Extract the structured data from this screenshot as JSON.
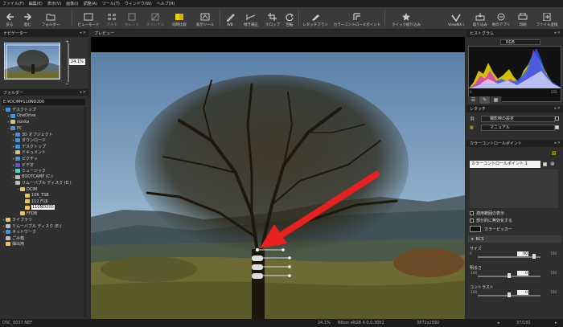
{
  "menu": [
    "ファイル(F)",
    "編集(E)",
    "表示(V)",
    "画像(I)",
    "調整(A)",
    "ツール(T)",
    "ウィンドウ(W)",
    "ヘルプ(H)"
  ],
  "toolbar": {
    "back": "戻る",
    "forward": "進む",
    "folder": "フォルダー",
    "viewer_mode": "ビューモード",
    "multi": "マルチ",
    "current": "カレント",
    "original": "オリジナル",
    "compare": "同時比較",
    "display_tool": "表示ツール",
    "wb": "WB",
    "tilt": "傾き補正",
    "crop": "クロップ",
    "rotate": "回転",
    "retouch_brush": "レタッチブラシ",
    "color_control_point": "カラーコントロールポイント",
    "quick_filter": "クイック絞り込み",
    "viewnx": "ViewNX-i",
    "import": "取り込み",
    "other_apps": "他のアプリ",
    "print": "印刷",
    "file_output": "ファイル変換"
  },
  "navigator": {
    "title": "ナビゲーター",
    "zoom": "24.1%"
  },
  "folder_panel": {
    "title": "フォルダー",
    "path": "E:¥DCIM¥110ND200",
    "tree": [
      {
        "label": "デスクトップ",
        "indent": 0,
        "color": "#4a90d9",
        "expander": "−"
      },
      {
        "label": "OneDrive",
        "indent": 1,
        "color": "#4a90d9",
        "expander": "+"
      },
      {
        "label": "nonka",
        "indent": 1,
        "color": "#d9c27a",
        "expander": "+"
      },
      {
        "label": "PC",
        "indent": 1,
        "color": "#4a90d9",
        "expander": "−"
      },
      {
        "label": "3D オブジェクト",
        "indent": 2,
        "color": "#4a90d9",
        "expander": "+"
      },
      {
        "label": "ダウンロード",
        "indent": 2,
        "color": "#4a90d9",
        "expander": "+"
      },
      {
        "label": "デスクトップ",
        "indent": 2,
        "color": "#4a90d9",
        "expander": "+"
      },
      {
        "label": "ドキュメント",
        "indent": 2,
        "color": "#d9c27a",
        "expander": "+"
      },
      {
        "label": "ピクチャ",
        "indent": 2,
        "color": "#4a90d9",
        "expander": "+"
      },
      {
        "label": "ビデオ",
        "indent": 2,
        "color": "#6a4ad9",
        "expander": "+"
      },
      {
        "label": "ミュージック",
        "indent": 2,
        "color": "#4ad9c2",
        "expander": "+"
      },
      {
        "label": "BOOTCAMP (C:)",
        "indent": 2,
        "color": "#bbbbbb",
        "expander": "+"
      },
      {
        "label": "リムーバブル ディスク (E:)",
        "indent": 2,
        "color": "#bbbbbb",
        "expander": "−"
      },
      {
        "label": "DCIM",
        "indent": 3,
        "color": "#e8c85a",
        "expander": "−"
      },
      {
        "label": "106_TSB",
        "indent": 4,
        "color": "#e8c85a",
        "expander": ""
      },
      {
        "label": "112 FUJI",
        "indent": 4,
        "color": "#e8c85a",
        "expander": ""
      },
      {
        "label": "110ND200",
        "indent": 4,
        "color": "#e8c85a",
        "expander": "",
        "selected": true
      },
      {
        "label": "FFDB",
        "indent": 3,
        "color": "#e8c85a",
        "expander": ""
      },
      {
        "label": "ライブラリ",
        "indent": 0,
        "color": "#e8c85a",
        "expander": "+"
      },
      {
        "label": "リムーバブル ディスク (E:)",
        "indent": 0,
        "color": "#bbbbbb",
        "expander": "+"
      },
      {
        "label": "ネットワーク",
        "indent": 0,
        "color": "#4a90d9",
        "expander": "+"
      },
      {
        "label": "ごみ箱",
        "indent": 0,
        "color": "#bbbbbb",
        "expander": ""
      },
      {
        "label": "抽出用",
        "indent": 0,
        "color": "#e8c85a",
        "expander": ""
      }
    ]
  },
  "preview": {
    "title": "プレビュー"
  },
  "histogram": {
    "title": "ヒストグラム",
    "channel": "RGB",
    "min": "0",
    "max": "255"
  },
  "retouch": {
    "title": "レタッチ",
    "row1": "撮影時の設定",
    "row2": "マニュアル"
  },
  "ccp": {
    "title": "カラーコントロールポイント",
    "point_name": "カラーコントロールポイント 1",
    "show_area": "適用範囲の表示",
    "disable_partial": "部分的に無効化する",
    "color_picker": "カラーピッカー",
    "group": "BCS",
    "sliders": [
      {
        "label": "サイズ",
        "min": "0",
        "max": "100",
        "value": "90",
        "fraction": 0.9
      },
      {
        "label": "明るさ",
        "min": "-100",
        "max": "100",
        "value": "0",
        "fraction": 0.5
      },
      {
        "label": "コントラスト",
        "min": "-100",
        "max": "100",
        "value": "0",
        "fraction": 0.5
      }
    ]
  },
  "status": {
    "filename": "DSC_0037.NEF",
    "zoom": "24.1%",
    "profile": "Nikon sRGB 4.0.0.3002",
    "dimensions": "3872x2592",
    "counter": "37/181"
  },
  "colors": {
    "arrow": "#e8201f",
    "selection": "#ffffff",
    "accent": "#f0d000"
  }
}
